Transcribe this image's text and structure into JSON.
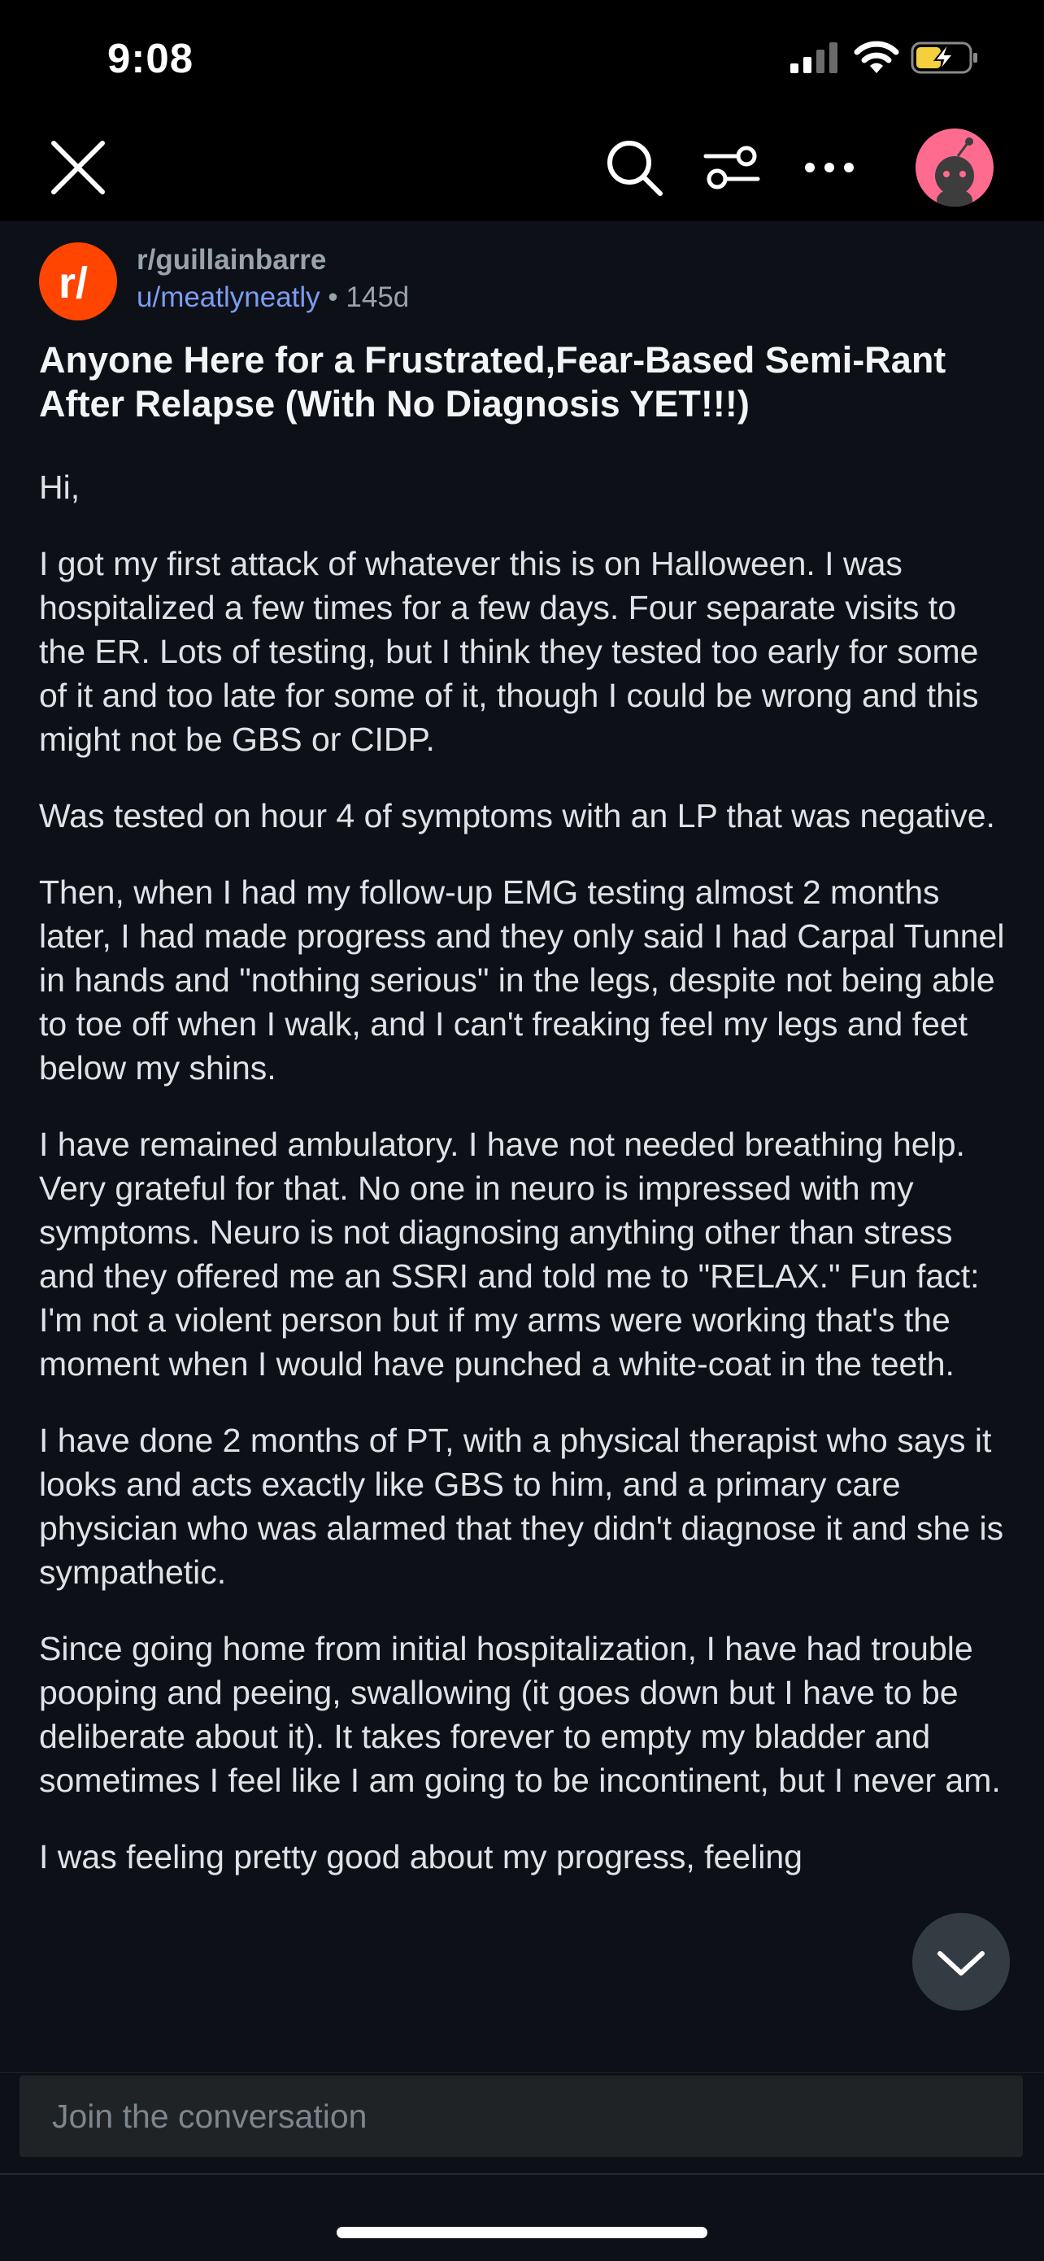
{
  "status_bar": {
    "time": "9:08"
  },
  "nav": {
    "icons": [
      "close-icon",
      "search-icon",
      "filter-icon",
      "more-icon",
      "avatar"
    ]
  },
  "post": {
    "subreddit": "r/guillainbarre",
    "author": "u/meatlyneatly",
    "separator": "•",
    "age": "145d",
    "title": "Anyone Here for a Frustrated,Fear-Based Semi-Rant After Relapse (With No Diagnosis YET!!!)",
    "paragraphs": [
      "Hi,",
      "I got my first attack of whatever this is on Halloween. I was hospitalized a few times for a few days. Four separate visits to the ER. Lots of testing, but I think they tested too early for some of it and too late for some of it, though I could be wrong and this might not be GBS or CIDP.",
      "Was tested on hour 4 of symptoms with an LP that was negative.",
      "Then, when I had my follow-up EMG testing almost 2 months later, I had made progress and they only said I had Carpal Tunnel in hands and \"nothing serious\" in the legs, despite not being able to toe off when I walk, and I can't freaking feel my legs and feet below my shins.",
      "I have remained ambulatory. I have not needed breathing help. Very grateful for that. No one in neuro is impressed with my symptoms. Neuro is not diagnosing anything other than stress and they offered me an SSRI and told me to \"RELAX.\" Fun fact: I'm not a violent person but if my arms were working that's the moment when I would have punched a white-coat in the teeth.",
      "I have done 2 months of PT, with a physical therapist who says it looks and acts exactly like GBS to him, and a primary care physician who was alarmed that they didn't diagnose it and she is sympathetic.",
      "Since going home from initial hospitalization, I have had trouble pooping and peeing, swallowing (it goes down but I have to be deliberate about it). It takes forever to empty my bladder and sometimes I feel like I am going to be incontinent, but I never am.",
      "I was feeling pretty good about my progress, feeling"
    ]
  },
  "composer": {
    "placeholder": "Join the conversation"
  },
  "colors": {
    "brand": "#ff4500",
    "author_link": "#7e9bf2",
    "background": "#0d1117",
    "avatar_bg": "#ff6b8f"
  }
}
